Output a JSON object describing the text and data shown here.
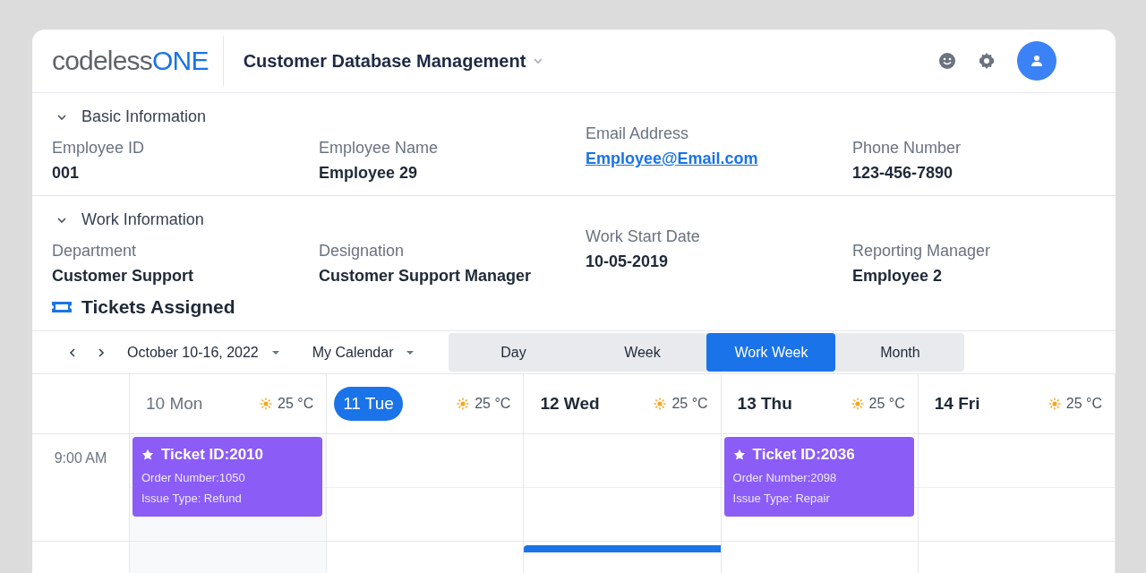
{
  "header": {
    "logo": {
      "text": "codeless",
      "accent": "ONE"
    },
    "app_title": "Customer Database Management"
  },
  "sections": [
    {
      "title": "Basic Information",
      "expanded": true,
      "fields": [
        {
          "label": "Employee ID",
          "value": "001",
          "kind": "text"
        },
        {
          "label": "Employee  Name",
          "value": "Employee 29",
          "kind": "text"
        },
        {
          "label": "Email Address",
          "value": "Employee@Email.com",
          "kind": "link"
        },
        {
          "label": "Phone Number",
          "value": "123-456-7890",
          "kind": "text"
        }
      ]
    },
    {
      "title": "Work Information",
      "expanded": true,
      "fields": [
        {
          "label": "Department",
          "value": "Customer Support",
          "kind": "text"
        },
        {
          "label": "Designation",
          "value": "Customer Support Manager",
          "kind": "text"
        },
        {
          "label": "Work Start Date",
          "value": "10-05-2019",
          "kind": "text"
        },
        {
          "label": "Reporting Manager",
          "value": "Employee 2",
          "kind": "text"
        }
      ]
    }
  ],
  "tickets_title": "Tickets Assigned",
  "calendar": {
    "range": "October 10-16, 2022",
    "calendar_name": "My Calendar",
    "views": [
      {
        "label": "Day",
        "selected": false
      },
      {
        "label": "Week",
        "selected": false
      },
      {
        "label": "Work Week",
        "selected": true
      },
      {
        "label": "Month",
        "selected": false
      }
    ],
    "times": [
      "9:00 AM"
    ],
    "days": [
      {
        "label": "10 Mon",
        "weather": "25 °C",
        "past": true,
        "selected": false,
        "events": [
          {
            "kind": "ticket",
            "title": "Ticket ID:2010",
            "lines": [
              "Order Number:1050",
              "Issue Type: Refund"
            ]
          }
        ]
      },
      {
        "label": "11 Tue",
        "weather": "25 °C",
        "past": false,
        "selected": true
      },
      {
        "label": "12 Wed",
        "weather": "25 °C",
        "past": false,
        "selected": false,
        "events": [
          {
            "kind": "partial"
          }
        ]
      },
      {
        "label": "13 Thu",
        "weather": "25 °C",
        "past": false,
        "selected": false,
        "events": [
          {
            "kind": "ticket",
            "title": "Ticket ID:2036",
            "lines": [
              "Order Number:2098",
              "Issue Type: Repair"
            ]
          }
        ]
      },
      {
        "label": "14 Fri",
        "weather": "25 °C",
        "past": false,
        "selected": false
      }
    ]
  }
}
